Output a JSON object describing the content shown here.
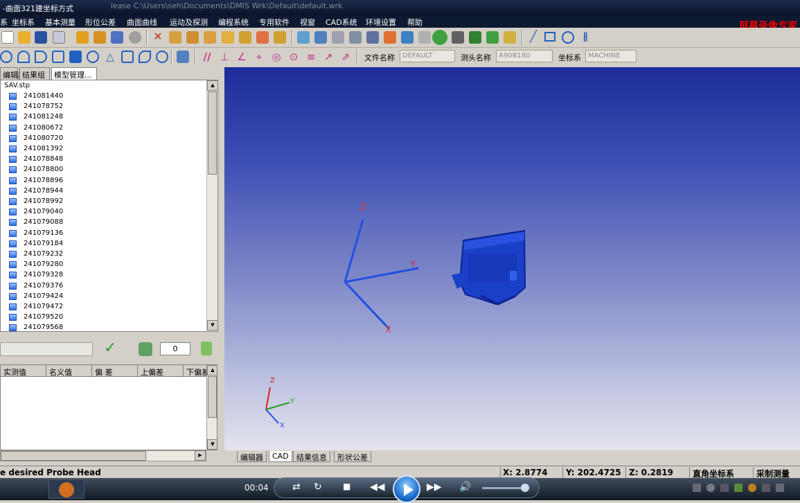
{
  "window": {
    "title": "-曲面321建坐标方式",
    "path": "lease    C:\\Users\\seh\\Documents\\DMIS Wrk\\Default\\default.wrk"
  },
  "menu": [
    "系",
    "坐标系",
    "基本测量",
    "形位公差",
    "曲面曲线",
    "运动及探测",
    "编程系统",
    "专用软件",
    "视窗",
    "CAD系统",
    "环境设置",
    "帮助"
  ],
  "recorder_watermark": "屏幕录像专家 ",
  "fields": {
    "file_label": "文件名称",
    "file_value": "DEFAULT",
    "probe_label": "测头名称",
    "probe_value": "A90B180",
    "coord_label": "坐标系",
    "coord_value": "MACHINE"
  },
  "left_tabs": [
    "编辑器",
    "结果组",
    "模型管理..."
  ],
  "tree": {
    "root": "SAV.stp",
    "items": [
      "241081440",
      "241078752",
      "241081248",
      "241080672",
      "241080720",
      "241081392",
      "241078848",
      "241078800",
      "241078896",
      "241078944",
      "241078992",
      "241079040",
      "241079088",
      "241079136",
      "241079184",
      "241079232",
      "241079280",
      "241079328",
      "241079376",
      "241079424",
      "241079472",
      "241079520",
      "241079568"
    ]
  },
  "count_value": "0",
  "table_headers": [
    "实测值",
    "名义值",
    "偏 差",
    "上偏差",
    "下偏差"
  ],
  "view_tabs": [
    "编辑器",
    "CAD",
    "结果信息",
    "形状公差"
  ],
  "axes": {
    "x": "X",
    "y": "Y",
    "z": "Z"
  },
  "status": {
    "message": "e desired Probe Head",
    "x": "X: 2.8774",
    "y": "Y: 202.4725",
    "z": "Z: 0.2819",
    "coord_type": "直角坐标系",
    "mode": "采制测量"
  },
  "player": {
    "time": "00:04"
  },
  "colors": {
    "axis_x": "#e03030",
    "axis_y": "#20a020",
    "axis_z": "#d02020",
    "axis_line": "#2050e0",
    "part": "#1a40c8"
  }
}
